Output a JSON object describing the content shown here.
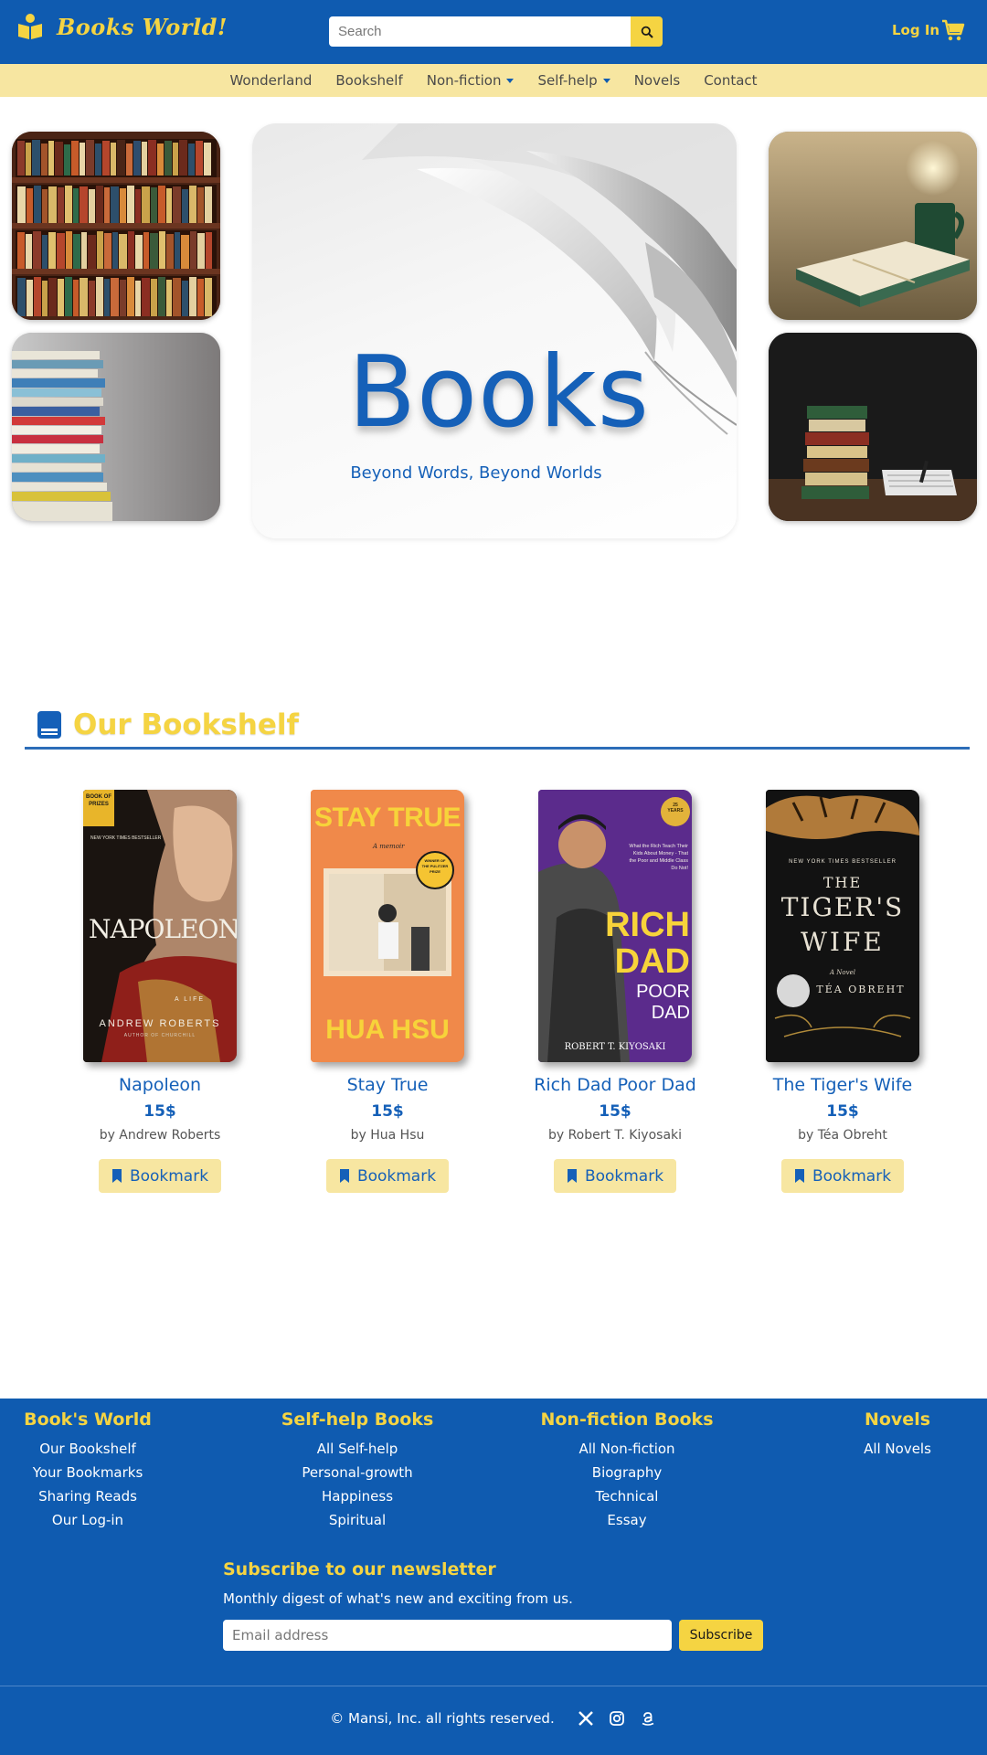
{
  "brand": {
    "name": "Books World!"
  },
  "search": {
    "placeholder": "Search"
  },
  "header": {
    "login": "Log In"
  },
  "nav": {
    "items": [
      {
        "label": "Wonderland",
        "dropdown": false
      },
      {
        "label": "Bookshelf",
        "dropdown": false
      },
      {
        "label": "Non-fiction",
        "dropdown": true
      },
      {
        "label": "Self-help",
        "dropdown": true
      },
      {
        "label": "Novels",
        "dropdown": false
      },
      {
        "label": "Contact",
        "dropdown": false
      }
    ]
  },
  "hero": {
    "title": "Books",
    "subtitle": "Beyond Words, Beyond Worlds"
  },
  "section": {
    "title": "Our Bookshelf"
  },
  "books": [
    {
      "title": "Napoleon",
      "price": "15$",
      "author": "by Andrew Roberts",
      "button": "Bookmark",
      "cover": {
        "main": "NAPOLEON",
        "top": "NEW YORK TIMES BESTSELLER",
        "badge": "BOOK OF PRIZES",
        "subtitle": "A LIFE",
        "author": "ANDREW ROBERTS",
        "footer": "AUTHOR OF CHURCHILL"
      }
    },
    {
      "title": "Stay True",
      "price": "15$",
      "author": "by Hua Hsu",
      "button": "Bookmark",
      "cover": {
        "main": "STAY TRUE",
        "subtitle": "A memoir",
        "badge": "WINNER OF THE PULITZER PRIZE",
        "author": "HUA HSU"
      }
    },
    {
      "title": "Rich Dad Poor Dad",
      "price": "15$",
      "author": "by Robert T. Kiyosaki",
      "button": "Bookmark",
      "cover": {
        "main1": "RICH",
        "main2": "DAD",
        "main3": "POOR DAD",
        "author": "ROBERT T. KIYOSAKI",
        "badge": "25 YEARS",
        "blurb": "What the Rich Teach Their Kids About Money - That the Poor and Middle Class Do Not!"
      }
    },
    {
      "title": "The Tiger's Wife",
      "price": "15$",
      "author": "by Téa Obreht",
      "button": "Bookmark",
      "cover": {
        "top": "NEW YORK TIMES BESTSELLER",
        "main1": "THE",
        "main2": "TIGER'S",
        "main3": "WIFE",
        "subtitle": "A Novel",
        "author": "TÉA OBREHT"
      }
    }
  ],
  "footer": {
    "columns": [
      {
        "heading": "Book's World",
        "links": [
          "Our Bookshelf",
          "Your Bookmarks",
          "Sharing Reads",
          "Our Log-in"
        ]
      },
      {
        "heading": "Self-help Books",
        "links": [
          "All Self-help",
          "Personal-growth",
          "Happiness",
          "Spiritual"
        ]
      },
      {
        "heading": "Non-fiction Books",
        "links": [
          "All Non-fiction",
          "Biography",
          "Technical",
          "Essay"
        ]
      },
      {
        "heading": "Novels",
        "links": [
          "All Novels"
        ]
      }
    ],
    "newsletter": {
      "title": "Subscribe to our newsletter",
      "subtitle": "Monthly digest of what's new and exciting from us.",
      "placeholder": "Email address",
      "button": "Subscribe"
    },
    "copyright": "© Mansi, Inc. all rights reserved.",
    "social": [
      "x-icon",
      "instagram-icon",
      "amazon-icon"
    ]
  },
  "colors": {
    "primary": "#0f5bb0",
    "accent": "#f5d442",
    "nav_bg": "#f7e6a1"
  }
}
